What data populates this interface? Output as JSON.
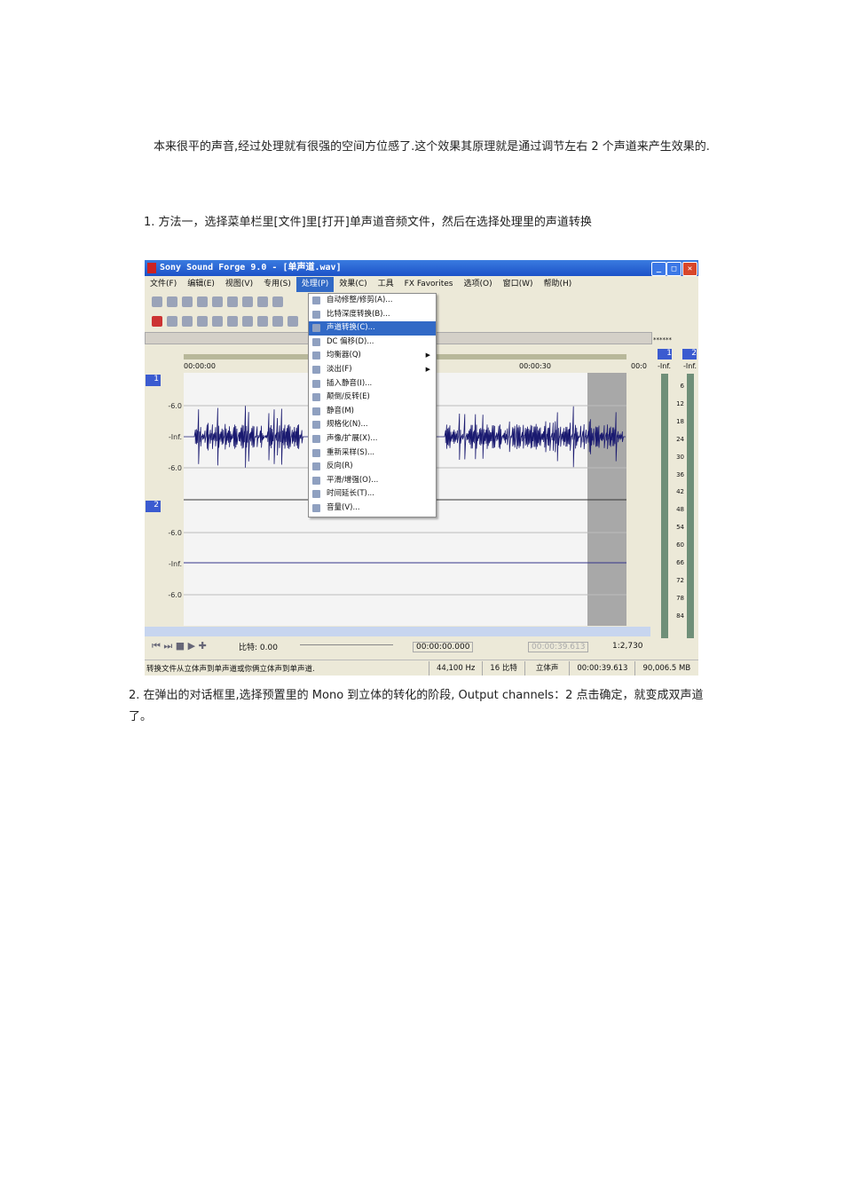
{
  "paragraphs": {
    "intro": "本来很平的声音,经过处理就有很强的空间方位感了.这个效果其原理就是通过调节左右 2 个声道来产生效果的.",
    "step1": "1. 方法一，选择菜单栏里[文件]里[打开]单声道音频文件，然后在选择处理里的声道转换",
    "step2": "2. 在弹出的对话框里,选择预置里的 Mono 到立体的转化的阶段, Output channels：2 点击确定，就变成双声道了。"
  },
  "app": {
    "title": "Sony Sound Forge 9.0 - [单声道.wav]",
    "menubar": [
      "文件(F)",
      "编辑(E)",
      "视图(V)",
      "专用(S)",
      "处理(P)",
      "效果(C)",
      "工具",
      "FX Favorites",
      "选项(O)",
      "窗口(W)",
      "帮助(H)"
    ],
    "process_menu": [
      {
        "label": "自动修整/修剪(A)..."
      },
      {
        "label": "比特深度转换(B)..."
      },
      {
        "label": "声道转换(C)...",
        "selected": true
      },
      {
        "label": "DC 偏移(D)..."
      },
      {
        "label": "均衡器(Q)",
        "submenu": true
      },
      {
        "label": "淡出(F)",
        "submenu": true
      },
      {
        "label": "插入静音(I)..."
      },
      {
        "label": "颠倒/反转(E)"
      },
      {
        "label": "静音(M)"
      },
      {
        "label": "规格化(N)..."
      },
      {
        "label": "声像/扩展(X)..."
      },
      {
        "label": "重新采样(S)..."
      },
      {
        "label": "反向(R)"
      },
      {
        "label": "平滑/增强(O)..."
      },
      {
        "label": "时间延长(T)..."
      },
      {
        "label": "音量(V)..."
      }
    ],
    "ruler": {
      "start": "00:00:00",
      "mid": "00:00:30",
      "end": "00:0"
    },
    "tracks": [
      {
        "num": "1"
      },
      {
        "num": "2"
      }
    ],
    "db_labels": [
      "-6.0",
      "-Inf.",
      "-6.0"
    ],
    "meter": {
      "header": "******",
      "ch": [
        "1",
        "2"
      ],
      "inf": "-Inf.",
      "scale": [
        "6",
        "12",
        "18",
        "24",
        "30",
        "36",
        "42",
        "48",
        "54",
        "60",
        "66",
        "72",
        "78",
        "84"
      ]
    },
    "transport": {
      "rate": "比特: 0.00",
      "pos": "00:00:00.000",
      "len": "00:00:39.613",
      "zoom": "1:2,730"
    },
    "status": {
      "hint": "转换文件从立体声到单声道或你俩立体声到单声道.",
      "rate": "44,100 Hz",
      "bits": "16 比特",
      "channels": "立体声",
      "length": "00:00:39.613",
      "space": "90,006.5 MB"
    }
  }
}
